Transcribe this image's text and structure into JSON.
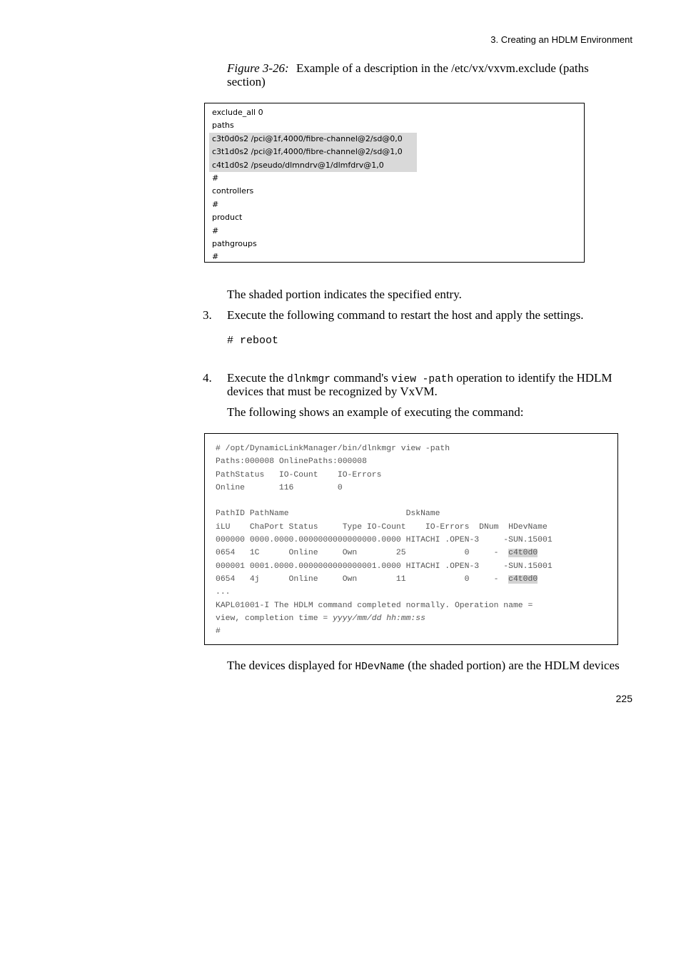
{
  "header": {
    "running_title": "3.  Creating an HDLM Environment"
  },
  "figure": {
    "label": "Figure  3-26:",
    "title": "Example of a description in the /etc/vx/vxvm.exclude (paths section)"
  },
  "exclude_file": {
    "lines": [
      {
        "text": "exclude_all 0",
        "shaded": false
      },
      {
        "text": "paths",
        "shaded": false
      },
      {
        "text": "c3t0d0s2 /pci@1f,4000/fibre-channel@2/sd@0,0",
        "shaded": true
      },
      {
        "text": "c3t1d0s2 /pci@1f,4000/fibre-channel@2/sd@1,0",
        "shaded": true
      },
      {
        "text": "c4t1d0s2 /pseudo/dlmndrv@1/dlmfdrv@1,0",
        "shaded": true
      },
      {
        "text": "#",
        "shaded": false
      },
      {
        "text": "controllers",
        "shaded": false
      },
      {
        "text": "#",
        "shaded": false
      },
      {
        "text": "product",
        "shaded": false
      },
      {
        "text": "#",
        "shaded": false
      },
      {
        "text": "pathgroups",
        "shaded": false
      },
      {
        "text": "#",
        "shaded": false
      }
    ]
  },
  "body": {
    "shaded_note": "The shaded portion indicates the specified entry.",
    "step3": {
      "number": "3.",
      "text": "Execute the following command to restart the host and apply the settings.",
      "command": "# reboot"
    },
    "step4": {
      "number": "4.",
      "text_1": "Execute the ",
      "code_1": "dlnkmgr",
      "text_2": " command's ",
      "code_2": "view -path",
      "text_3": " operation to identify the HDLM",
      "text_line2": "devices that must be recognized by VxVM.",
      "example_intro": "The following shows an example of executing the command:"
    },
    "final": {
      "text_1": "The devices displayed for ",
      "code": "HDevName",
      "text_2": " (the shaded portion) are the HDLM devices"
    }
  },
  "command_output": {
    "lines": [
      {
        "pre": "# /opt/DynamicLinkManager/bin/dlnkmgr view -path"
      },
      {
        "pre": "Paths:000008 OnlinePaths:000008"
      },
      {
        "pre": "PathStatus   IO-Count    IO-Errors"
      },
      {
        "pre": "Online       116         0"
      },
      {
        "pre": " "
      },
      {
        "pre": "PathID PathName                        DskName"
      },
      {
        "pre": "iLU    ChaPort Status     Type IO-Count    IO-Errors  DNum  HDevName"
      },
      {
        "pre": "000000 0000.0000.0000000000000000.0000 HITACHI .OPEN-3     -SUN.15001"
      },
      {
        "pre": "0654   1C      Online     Own        25            0     -  ",
        "hl": "c4t0d0"
      },
      {
        "pre": "000001 0001.0000.0000000000000001.0000 HITACHI .OPEN-3     -SUN.15001"
      },
      {
        "pre": "0654   4j      Online     Own        11            0     -  ",
        "hl": "c4t0d0"
      },
      {
        "pre": "..."
      },
      {
        "pre": "KAPL01001-I The HDLM command completed normally. Operation name ="
      },
      {
        "pre": "view, completion time = ",
        "it": "yyyy/mm/dd hh:mm:ss"
      },
      {
        "pre": "#"
      }
    ]
  },
  "footer": {
    "page_number": "225"
  }
}
